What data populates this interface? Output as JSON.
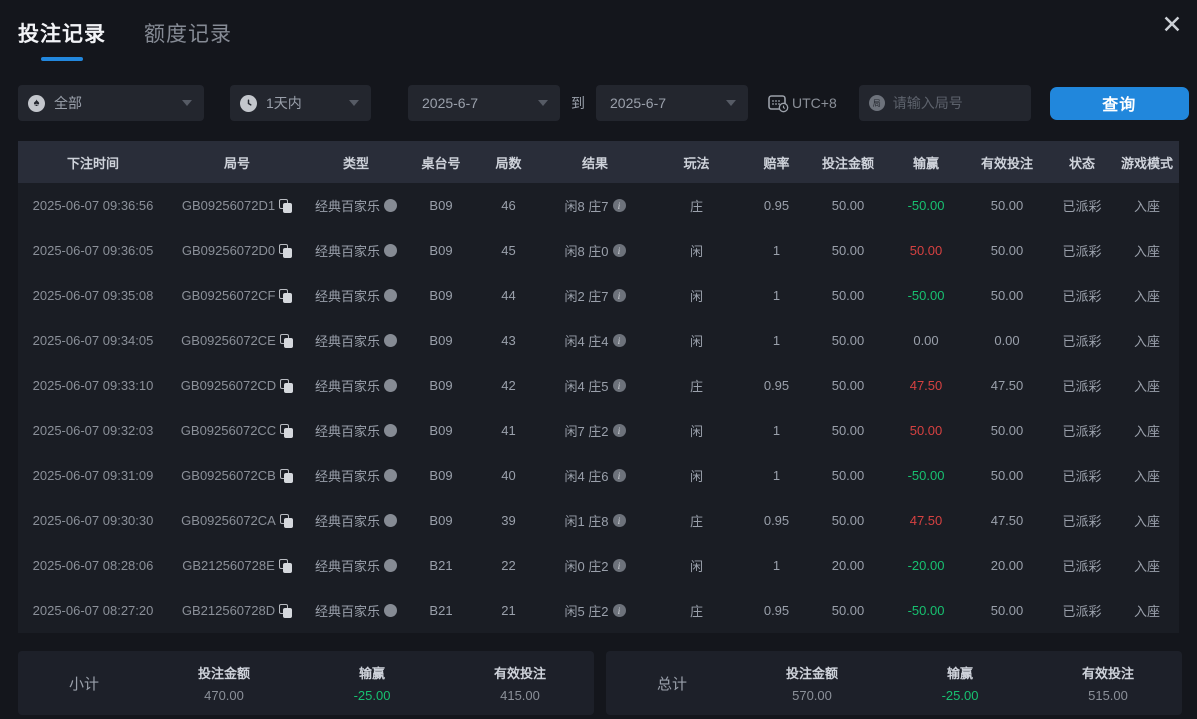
{
  "window": {
    "close_label": "✕"
  },
  "tabs": [
    {
      "label": "投注记录",
      "active": true
    },
    {
      "label": "额度记录",
      "active": false
    }
  ],
  "filters": {
    "game_type": {
      "value": "全部",
      "icon": "spade-icon"
    },
    "time_range": {
      "value": "1天内",
      "icon": "clock-icon"
    },
    "date_from": "2025-6-7",
    "to_label": "到",
    "date_to": "2025-6-7",
    "timezone": "UTC+8",
    "round_input": {
      "value": "",
      "placeholder": "请输入局号",
      "icon_char": "局"
    },
    "query_button": "查询"
  },
  "table": {
    "headers": [
      "下注时间",
      "局号",
      "类型",
      "桌台号",
      "局数",
      "结果",
      "玩法",
      "赔率",
      "投注金额",
      "输赢",
      "有效投注",
      "状态",
      "游戏模式"
    ],
    "rows": [
      {
        "time": "2025-06-07 09:36:56",
        "round_id": "GB09256072D1",
        "type": "经典百家乐",
        "table_no": "B09",
        "round_no": "46",
        "result": "闲8 庄7",
        "play": "庄",
        "odds": "0.95",
        "bet": "50.00",
        "win_loss": "-50.00",
        "valid_bet": "50.00",
        "status": "已派彩",
        "mode": "入座"
      },
      {
        "time": "2025-06-07 09:36:05",
        "round_id": "GB09256072D0",
        "type": "经典百家乐",
        "table_no": "B09",
        "round_no": "45",
        "result": "闲8 庄0",
        "play": "闲",
        "odds": "1",
        "bet": "50.00",
        "win_loss": "50.00",
        "valid_bet": "50.00",
        "status": "已派彩",
        "mode": "入座"
      },
      {
        "time": "2025-06-07 09:35:08",
        "round_id": "GB09256072CF",
        "type": "经典百家乐",
        "table_no": "B09",
        "round_no": "44",
        "result": "闲2 庄7",
        "play": "闲",
        "odds": "1",
        "bet": "50.00",
        "win_loss": "-50.00",
        "valid_bet": "50.00",
        "status": "已派彩",
        "mode": "入座"
      },
      {
        "time": "2025-06-07 09:34:05",
        "round_id": "GB09256072CE",
        "type": "经典百家乐",
        "table_no": "B09",
        "round_no": "43",
        "result": "闲4 庄4",
        "play": "闲",
        "odds": "1",
        "bet": "50.00",
        "win_loss": "0.00",
        "valid_bet": "0.00",
        "status": "已派彩",
        "mode": "入座"
      },
      {
        "time": "2025-06-07 09:33:10",
        "round_id": "GB09256072CD",
        "type": "经典百家乐",
        "table_no": "B09",
        "round_no": "42",
        "result": "闲4 庄5",
        "play": "庄",
        "odds": "0.95",
        "bet": "50.00",
        "win_loss": "47.50",
        "valid_bet": "47.50",
        "status": "已派彩",
        "mode": "入座"
      },
      {
        "time": "2025-06-07 09:32:03",
        "round_id": "GB09256072CC",
        "type": "经典百家乐",
        "table_no": "B09",
        "round_no": "41",
        "result": "闲7 庄2",
        "play": "闲",
        "odds": "1",
        "bet": "50.00",
        "win_loss": "50.00",
        "valid_bet": "50.00",
        "status": "已派彩",
        "mode": "入座"
      },
      {
        "time": "2025-06-07 09:31:09",
        "round_id": "GB09256072CB",
        "type": "经典百家乐",
        "table_no": "B09",
        "round_no": "40",
        "result": "闲4 庄6",
        "play": "闲",
        "odds": "1",
        "bet": "50.00",
        "win_loss": "-50.00",
        "valid_bet": "50.00",
        "status": "已派彩",
        "mode": "入座"
      },
      {
        "time": "2025-06-07 09:30:30",
        "round_id": "GB09256072CA",
        "type": "经典百家乐",
        "table_no": "B09",
        "round_no": "39",
        "result": "闲1 庄8",
        "play": "庄",
        "odds": "0.95",
        "bet": "50.00",
        "win_loss": "47.50",
        "valid_bet": "47.50",
        "status": "已派彩",
        "mode": "入座"
      },
      {
        "time": "2025-06-07 08:28:06",
        "round_id": "GB212560728E",
        "type": "经典百家乐",
        "table_no": "B21",
        "round_no": "22",
        "result": "闲0 庄2",
        "play": "闲",
        "odds": "1",
        "bet": "20.00",
        "win_loss": "-20.00",
        "valid_bet": "20.00",
        "status": "已派彩",
        "mode": "入座"
      },
      {
        "time": "2025-06-07 08:27:20",
        "round_id": "GB212560728D",
        "type": "经典百家乐",
        "table_no": "B21",
        "round_no": "21",
        "result": "闲5 庄2",
        "play": "庄",
        "odds": "0.95",
        "bet": "50.00",
        "win_loss": "-50.00",
        "valid_bet": "50.00",
        "status": "已派彩",
        "mode": "入座"
      }
    ]
  },
  "summary": {
    "subtotal": {
      "label": "小计",
      "bet_label": "投注金额",
      "bet": "470.00",
      "win_label": "输赢",
      "win": "-25.00",
      "valid_label": "有效投注",
      "valid": "415.00"
    },
    "total": {
      "label": "总计",
      "bet_label": "投注金额",
      "bet": "570.00",
      "win_label": "输赢",
      "win": "-25.00",
      "valid_label": "有效投注",
      "valid": "515.00"
    }
  },
  "colors": {
    "accent": "#2187dc",
    "win_positive": "#d64141",
    "win_negative": "#17c070",
    "header_bg": "#292d39",
    "body_bg": "#1a1d24"
  }
}
